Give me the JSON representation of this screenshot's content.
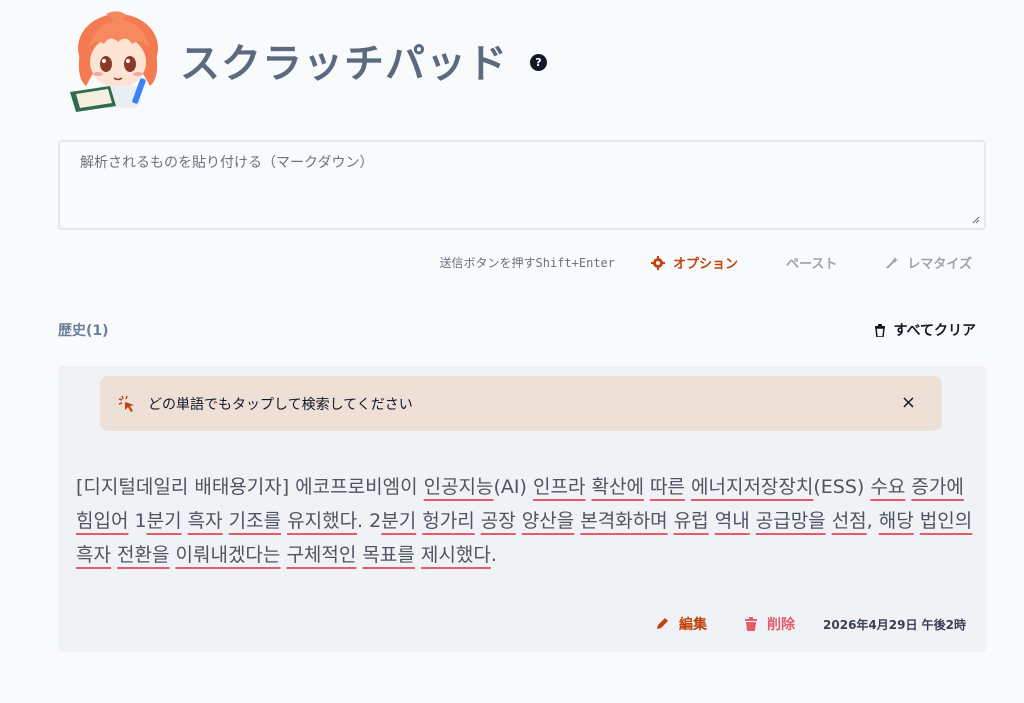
{
  "app": {
    "title": "スクラッチパッド",
    "help_icon": "question-circle-icon",
    "avatar": "anime-girl-reading-book"
  },
  "input": {
    "placeholder": "解析されるものを貼り付ける（マークダウン）",
    "value": ""
  },
  "toolbar": {
    "hint": "送信ボタンを押すShift+Enter",
    "options_label": "オプション",
    "paste_label": "ペースト",
    "romanize_label": "レマタイズ"
  },
  "history": {
    "label": "歴史(1)",
    "clear_all_label": "すべてクリア"
  },
  "tip": {
    "text": "どの単語でもタップして検索してください",
    "close": "×"
  },
  "entry": {
    "segments": [
      {
        "t": "[디지털데일리 배태용기자] 에코프로비엠이 ",
        "u": false
      },
      {
        "t": "인공지능",
        "u": true
      },
      {
        "t": "(AI) ",
        "u": false
      },
      {
        "t": "인프라",
        "u": true
      },
      {
        "t": " ",
        "u": false
      },
      {
        "t": "확산에",
        "u": true
      },
      {
        "t": " ",
        "u": false
      },
      {
        "t": "따른",
        "u": true
      },
      {
        "t": " ",
        "u": false
      },
      {
        "t": "에너지저장장치",
        "u": true
      },
      {
        "t": "(ESS) ",
        "u": false
      },
      {
        "t": "수요",
        "u": true
      },
      {
        "t": " ",
        "u": false
      },
      {
        "t": "증가에",
        "u": true
      },
      {
        "t": " ",
        "u": false
      },
      {
        "t": "힘입어",
        "u": true
      },
      {
        "t": " 1",
        "u": false
      },
      {
        "t": "분기",
        "u": true
      },
      {
        "t": " ",
        "u": false
      },
      {
        "t": "흑자",
        "u": true
      },
      {
        "t": " ",
        "u": false
      },
      {
        "t": "기조를",
        "u": true
      },
      {
        "t": " ",
        "u": false
      },
      {
        "t": "유지했다",
        "u": true
      },
      {
        "t": ". 2",
        "u": false
      },
      {
        "t": "분기",
        "u": true
      },
      {
        "t": " ",
        "u": false
      },
      {
        "t": "헝가리",
        "u": true
      },
      {
        "t": " ",
        "u": false
      },
      {
        "t": "공장",
        "u": true
      },
      {
        "t": " ",
        "u": false
      },
      {
        "t": "양산을",
        "u": true
      },
      {
        "t": " ",
        "u": false
      },
      {
        "t": "본격화하며",
        "u": true
      },
      {
        "t": " ",
        "u": false
      },
      {
        "t": "유럽",
        "u": true
      },
      {
        "t": " ",
        "u": false
      },
      {
        "t": "역내",
        "u": true
      },
      {
        "t": " ",
        "u": false
      },
      {
        "t": "공급망을",
        "u": true
      },
      {
        "t": " ",
        "u": false
      },
      {
        "t": "선점",
        "u": true
      },
      {
        "t": ", ",
        "u": false
      },
      {
        "t": "해당",
        "u": true
      },
      {
        "t": " ",
        "u": false
      },
      {
        "t": "법인의",
        "u": true
      },
      {
        "t": " ",
        "u": false
      },
      {
        "t": "흑자",
        "u": true
      },
      {
        "t": " ",
        "u": false
      },
      {
        "t": "전환을",
        "u": true
      },
      {
        "t": " ",
        "u": false
      },
      {
        "t": "이뤄내겠다는",
        "u": true
      },
      {
        "t": " ",
        "u": false
      },
      {
        "t": "구체적인",
        "u": true
      },
      {
        "t": " ",
        "u": false
      },
      {
        "t": "목표를",
        "u": true
      },
      {
        "t": " ",
        "u": false
      },
      {
        "t": "제시했다",
        "u": true
      },
      {
        "t": ".",
        "u": false
      }
    ],
    "edit_label": "編集",
    "delete_label": "削除",
    "timestamp": "2026年4月29日 午後2時"
  },
  "colors": {
    "accent": "#c2410c",
    "danger": "#e25c6b",
    "title": "#5b6b7f",
    "tip_bg": "#efe0d7",
    "card_bg": "#f1f2f6"
  }
}
